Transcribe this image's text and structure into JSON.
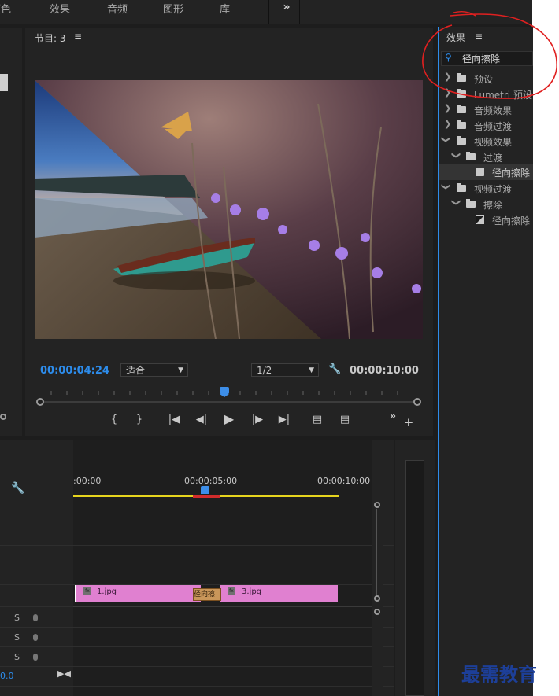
{
  "workspace_tabs": [
    "颜色",
    "效果",
    "音频",
    "图形",
    "库"
  ],
  "workspace_more": "»",
  "monitor": {
    "title": "节目: 3",
    "menu_icon": "≡",
    "timecode_current": "00:00:04:24",
    "fit_label": "适合",
    "resolution_label": "1/2",
    "timecode_duration": "00:00:10:00",
    "transport_more": "»",
    "add_icon": "+"
  },
  "effects_panel": {
    "title": "效果",
    "menu_icon": "≡",
    "search_value": "径向擦除",
    "tree": [
      {
        "label": "预设",
        "indent": 0,
        "icon": "preset-folder",
        "expanded": false
      },
      {
        "label": "Lumetri 预设",
        "indent": 0,
        "icon": "preset-folder",
        "expanded": false
      },
      {
        "label": "音频效果",
        "indent": 0,
        "icon": "folder",
        "expanded": false
      },
      {
        "label": "音频过渡",
        "indent": 0,
        "icon": "folder",
        "expanded": false
      },
      {
        "label": "视频效果",
        "indent": 0,
        "icon": "folder",
        "expanded": true
      },
      {
        "label": "过渡",
        "indent": 1,
        "icon": "folder",
        "expanded": true
      },
      {
        "label": "径向擦除",
        "indent": 2,
        "icon": "effect",
        "selected": true
      },
      {
        "label": "视频过渡",
        "indent": 0,
        "icon": "folder",
        "expanded": true
      },
      {
        "label": "擦除",
        "indent": 1,
        "icon": "folder",
        "expanded": true
      },
      {
        "label": "径向擦除",
        "indent": 2,
        "icon": "transition"
      }
    ]
  },
  "timeline": {
    "ruler_labels": [
      ":00:00",
      "00:00:05:00",
      "00:00:10:00"
    ],
    "clip1_name": "1.jpg",
    "clip2_name": "3.jpg",
    "transition_name": "径向擦",
    "audio_track_solo": [
      "S",
      "S",
      "S"
    ],
    "track_value": "0.0"
  },
  "watermark": "最需教育",
  "colors": {
    "accent_blue": "#2d8ceb",
    "clip_pink": "#e080d0",
    "transition_tan": "#c9965a",
    "work_area_yellow": "#e6d41e",
    "annotation_red": "#e02020"
  }
}
